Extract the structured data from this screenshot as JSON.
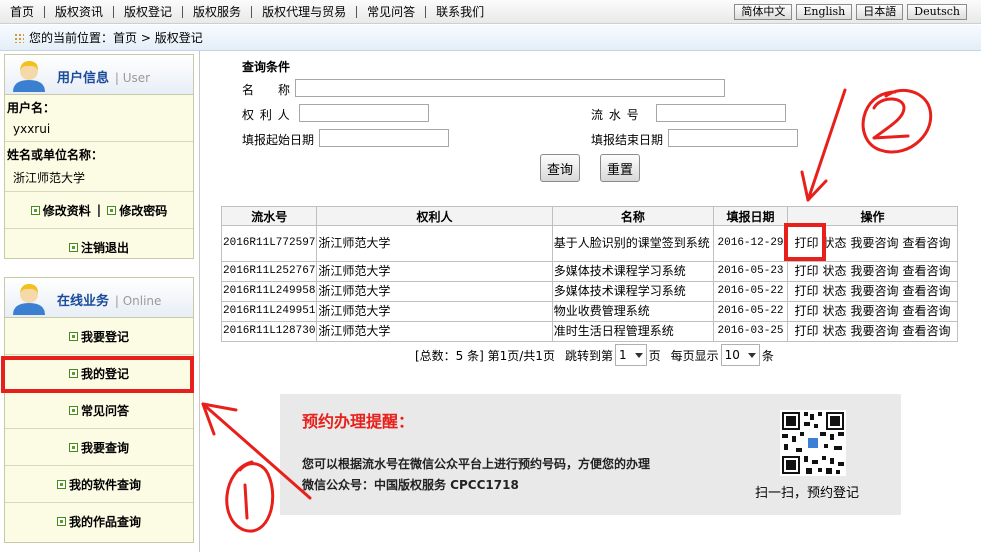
{
  "topnav": {
    "links": [
      "首页",
      "版权资讯",
      "版权登记",
      "版权服务",
      "版权代理与贸易",
      "常见问答",
      "联系我们"
    ],
    "languages": [
      "简体中文",
      "English",
      "日本語",
      "Deutsch"
    ]
  },
  "breadcrumb": {
    "prefix": "您的当前位置：",
    "path": "首页 > 版权登记"
  },
  "sidebar": {
    "user_panel": {
      "title": "用户信息",
      "title_en": "User",
      "username_label": "用户名：",
      "username": "yxxrui",
      "org_label": "姓名或单位名称：",
      "org": "浙江师范大学",
      "edit_profile": "修改资料",
      "separator": "|",
      "edit_password": "修改密码",
      "logout": "注销退出"
    },
    "online_panel": {
      "title": "在线业务",
      "title_en": "Online",
      "items": [
        "我要登记",
        "我的登记",
        "常见问答",
        "我要查询",
        "我的软件查询",
        "我的作品查询"
      ]
    }
  },
  "query": {
    "title": "查询条件",
    "name_label": "名　称",
    "rightholder_label": "权 利 人",
    "serial_label": "流 水 号",
    "start_date_label": "填报起始日期",
    "end_date_label": "填报结束日期",
    "search_button": "查询",
    "reset_button": "重置"
  },
  "table": {
    "headers": [
      "流水号",
      "权利人",
      "名称",
      "填报日期",
      "操作"
    ],
    "rows": [
      {
        "serial": "2016R11L772597",
        "owner": "浙江师范大学",
        "name": "基于人脸识别的课堂签到系统",
        "date": "2016-12-29"
      },
      {
        "serial": "2016R11L252767",
        "owner": "浙江师范大学",
        "name": "多媒体技术课程学习系统",
        "date": "2016-05-23"
      },
      {
        "serial": "2016R11L249958",
        "owner": "浙江师范大学",
        "name": "多媒体技术课程学习系统",
        "date": "2016-05-22"
      },
      {
        "serial": "2016R11L249951",
        "owner": "浙江师范大学",
        "name": "物业收费管理系统",
        "date": "2016-05-22"
      },
      {
        "serial": "2016R11L128730",
        "owner": "浙江师范大学",
        "name": "准时生活日程管理系统",
        "date": "2016-03-25"
      }
    ],
    "ops": [
      "打印",
      "状态",
      "我要咨询",
      "查看咨询"
    ]
  },
  "pager": {
    "total": "[总数：5 条] 第1页/共1页",
    "jump_prefix": "跳转到第",
    "page_value": "1",
    "page_suffix": "页",
    "per_page_prefix": "每页显示",
    "per_page_value": "10",
    "per_page_suffix": "条"
  },
  "notice": {
    "title": "预约办理提醒：",
    "line1": "您可以根据流水号在微信公众平台上进行预约号码，方便您的办理",
    "line2": "微信公众号：中国版权服务 CPCC1718",
    "scan_text": "扫一扫，预约登记"
  },
  "annotation_colors": {
    "red": "#e8201b"
  }
}
